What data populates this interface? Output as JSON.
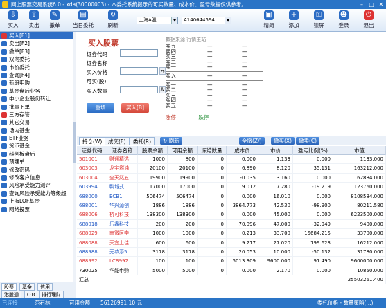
{
  "window": {
    "title": "网上股票交易系统6.0 - xda(30000003) - 本委托系统提示的可买数量、成本价、盈亏数据仅供参考。"
  },
  "toolbar": {
    "left_buttons": [
      {
        "label": "买入",
        "icon": "buy-icon",
        "color": "#2b6cc4"
      },
      {
        "label": "卖出",
        "icon": "sell-icon",
        "color": "#2b6cc4"
      },
      {
        "label": "撤单",
        "icon": "cancel-order-icon",
        "color": "#2b6cc4"
      },
      {
        "label": "当日委托",
        "icon": "daily-orders-icon",
        "color": "#2b6cc4"
      },
      {
        "label": "刷新",
        "icon": "refresh-icon",
        "color": "#2b6cc4"
      }
    ],
    "market_select": "上海A股",
    "account_select": "A140644594",
    "right_buttons": [
      {
        "label": "精简",
        "icon": "compact-icon",
        "color": "#2b6cc4"
      },
      {
        "label": "添加",
        "icon": "add-icon",
        "color": "#2b6cc4"
      },
      {
        "label": "锁屏",
        "icon": "lock-icon",
        "color": "#2b6cc4"
      },
      {
        "label": "登录",
        "icon": "login-icon",
        "color": "#2b6cc4"
      },
      {
        "label": "退出",
        "icon": "exit-icon",
        "color": "#d33"
      }
    ]
  },
  "sidebar": {
    "items": [
      {
        "label": "买入[F1]",
        "icon": "buy-icon",
        "color": "#d33",
        "active": true
      },
      {
        "label": "卖出[F2]",
        "icon": "sell-icon",
        "color": "#2b6cc4"
      },
      {
        "label": "撤单[F3]",
        "icon": "cancel-icon",
        "color": "#2b6cc4"
      },
      {
        "label": "双向委托",
        "icon": "two-way-icon",
        "color": "#2b6cc4"
      },
      {
        "label": "市价委托",
        "icon": "market-order-icon",
        "color": "#2b6cc4"
      },
      {
        "label": "查询[F4]",
        "icon": "query-icon",
        "color": "#2b6cc4"
      },
      {
        "label": "新股申购",
        "icon": "ipo-icon",
        "color": "#2b6cc4"
      },
      {
        "label": "基金盘后业务",
        "icon": "fund-icon",
        "color": "#2b6cc4"
      },
      {
        "label": "中小企业股份转让",
        "icon": "transfer-icon",
        "color": "#2b6cc4"
      },
      {
        "label": "批量下单",
        "icon": "batch-icon",
        "color": "#2b6cc4"
      },
      {
        "label": "三方存管",
        "icon": "bank-icon",
        "color": "#d33"
      },
      {
        "label": "其它交易",
        "icon": "other-icon",
        "color": "#2b6cc4"
      },
      {
        "label": "场内基金",
        "icon": "fund-icon",
        "color": "#2b6cc4"
      },
      {
        "label": "ETF业务",
        "icon": "etf-icon",
        "color": "#2b6cc4"
      },
      {
        "label": "货币基金",
        "icon": "money-fund-icon",
        "color": "#2b6cc4"
      },
      {
        "label": "科创板盘后",
        "icon": "star-icon",
        "color": "#2b6cc4"
      },
      {
        "label": "预埋单",
        "icon": "preorder-icon",
        "color": "#2b6cc4"
      },
      {
        "label": "修改密码",
        "icon": "key-icon",
        "color": "#2b6cc4"
      },
      {
        "label": "修改客户信息",
        "icon": "user-icon",
        "color": "#2b6cc4"
      },
      {
        "label": "风险承受能力测评",
        "icon": "risk-icon",
        "color": "#2b6cc4"
      },
      {
        "label": "查询风险承受能力等级超",
        "icon": "risk-query-icon",
        "color": "#2b6cc4"
      },
      {
        "label": "上海LOF基金",
        "icon": "lof-icon",
        "color": "#2b6cc4"
      },
      {
        "label": "网络投票",
        "icon": "vote-icon",
        "color": "#2b6cc4"
      }
    ],
    "tabs_row1": [
      "股票",
      "基金",
      "信用"
    ],
    "tabs_row2": [
      "港股通",
      "OTC",
      "排行理财"
    ]
  },
  "form": {
    "title": "买入股票",
    "labels": {
      "code": "证券代码",
      "name": "证券名称",
      "price": "买入价格",
      "available": "可买(股)",
      "qty": "买入数量"
    },
    "unit_price": "元",
    "unit_qty": "股",
    "reset_label": "重填",
    "buy_label": "买入[B]"
  },
  "quote": {
    "source": "数据来源  行情主站",
    "sell_rows": [
      {
        "label": "卖五",
        "v1": "—",
        "v2": "—"
      },
      {
        "label": "卖四",
        "v1": "—",
        "v2": "—"
      },
      {
        "label": "卖三",
        "v1": "—",
        "v2": "—"
      },
      {
        "label": "卖二",
        "v1": "—",
        "v2": "—"
      },
      {
        "label": "卖一",
        "v1": "—",
        "v2": "—"
      }
    ],
    "latest_row": {
      "label": "买入",
      "v1": "—",
      "v2": "—"
    },
    "buy_rows": [
      {
        "label": "买一",
        "v1": "—",
        "v2": "—"
      },
      {
        "label": "买二",
        "v1": "—",
        "v2": "—"
      },
      {
        "label": "买三",
        "v1": "—",
        "v2": "—"
      },
      {
        "label": "买四",
        "v1": "—",
        "v2": "—"
      },
      {
        "label": "买五",
        "v1": "—",
        "v2": "—"
      }
    ],
    "limit_up": "涨停",
    "limit_up_val": "—",
    "limit_down": "跌停",
    "limit_down_val": "—"
  },
  "tabs": {
    "items": [
      "持仓(W)",
      "成交(E)",
      "委托(R)"
    ],
    "refresh_label": "刷新",
    "action_buttons": [
      "全撤(Z/)",
      "撤买(X)",
      "撤卖(C)"
    ]
  },
  "table": {
    "columns": [
      "证券代码",
      "证券名称",
      "股票余额",
      "可用余额",
      "冻结数量",
      "成本价",
      "市价",
      "盈亏比例(%)",
      "市值"
    ],
    "rows": [
      {
        "code": "501001",
        "name": "财通精选",
        "balance": "1000",
        "available": "800",
        "frozen": "0",
        "cost": "0.000",
        "price": "1.133",
        "ratio": "0.000",
        "value": "1133.000",
        "color": "red"
      },
      {
        "code": "603003",
        "name": "龙宇燃油",
        "balance": "20100",
        "available": "20100",
        "frozen": "0",
        "cost": "6.890",
        "price": "8.120",
        "ratio": "35.131",
        "value": "163212.000",
        "color": "red"
      },
      {
        "code": "603004",
        "name": "全天然五",
        "balance": "19900",
        "available": "19900",
        "frozen": "0",
        "cost": "-0.035",
        "price": "3.160",
        "ratio": "0.000",
        "value": "62884.000",
        "color": "red"
      },
      {
        "code": "603994",
        "name": "鸭城式",
        "balance": "17000",
        "available": "17000",
        "frozen": "0",
        "cost": "9.012",
        "price": "7.280",
        "ratio": "-19.219",
        "value": "123760.000",
        "color": "blue"
      },
      {
        "code": "688000",
        "name": "ECB1",
        "balance": "506474",
        "available": "506474",
        "frozen": "0",
        "cost": "0.000",
        "price": "16.010",
        "ratio": "0.000",
        "value": "8108584.000",
        "color": "blue"
      },
      {
        "code": "688001",
        "name": "华兴源创",
        "balance": "1886",
        "available": "1886",
        "frozen": "0",
        "cost": "3864.773",
        "price": "42.530",
        "ratio": "-98.900",
        "value": "80211.580",
        "color": "blue"
      },
      {
        "code": "688006",
        "name": "杭可科技",
        "balance": "138300",
        "available": "138300",
        "frozen": "0",
        "cost": "0.000",
        "price": "45.000",
        "ratio": "0.000",
        "value": "6223500.000",
        "color": "red"
      },
      {
        "code": "688018",
        "name": "乐鑫科技",
        "balance": "200",
        "available": "200",
        "frozen": "0",
        "cost": "70.096",
        "price": "47.000",
        "ratio": "-32.949",
        "value": "9400.000",
        "color": "blue"
      },
      {
        "code": "688029",
        "name": "南微医学",
        "balance": "1000",
        "available": "1000",
        "frozen": "0",
        "cost": "0.213",
        "price": "33.700",
        "ratio": "15684.215",
        "value": "33700.000",
        "color": "red"
      },
      {
        "code": "688088",
        "name": "天宜上佳",
        "balance": "600",
        "available": "600",
        "frozen": "0",
        "cost": "9.217",
        "price": "27.020",
        "ratio": "199.623",
        "value": "16212.000",
        "color": "red"
      },
      {
        "code": "688988",
        "name": "无恭添5",
        "balance": "3178",
        "available": "3178",
        "frozen": "0",
        "cost": "20.053",
        "price": "10.000",
        "ratio": "-50.132",
        "value": "31780.000",
        "color": "blue"
      },
      {
        "code": "688992",
        "name": "LCB992",
        "balance": "100",
        "available": "100",
        "frozen": "0",
        "cost": "5013.309",
        "price": "9600.000",
        "ratio": "91.490",
        "value": "9600000.000",
        "color": "red"
      },
      {
        "code": "730025",
        "name": "华能申购",
        "balance": "5000",
        "available": "5000",
        "frozen": "0",
        "cost": "0.000",
        "price": "2.170",
        "ratio": "0.000",
        "value": "10850.000",
        "color": "black"
      }
    ],
    "summary_label": "汇总",
    "summary_value": "25503261.400"
  },
  "status": {
    "connection": "已连接",
    "server": "范石林",
    "funds_label": "可用金额",
    "funds_value": "56126991.10 元",
    "right_text": "委托价格 - 数量策略(...)"
  }
}
